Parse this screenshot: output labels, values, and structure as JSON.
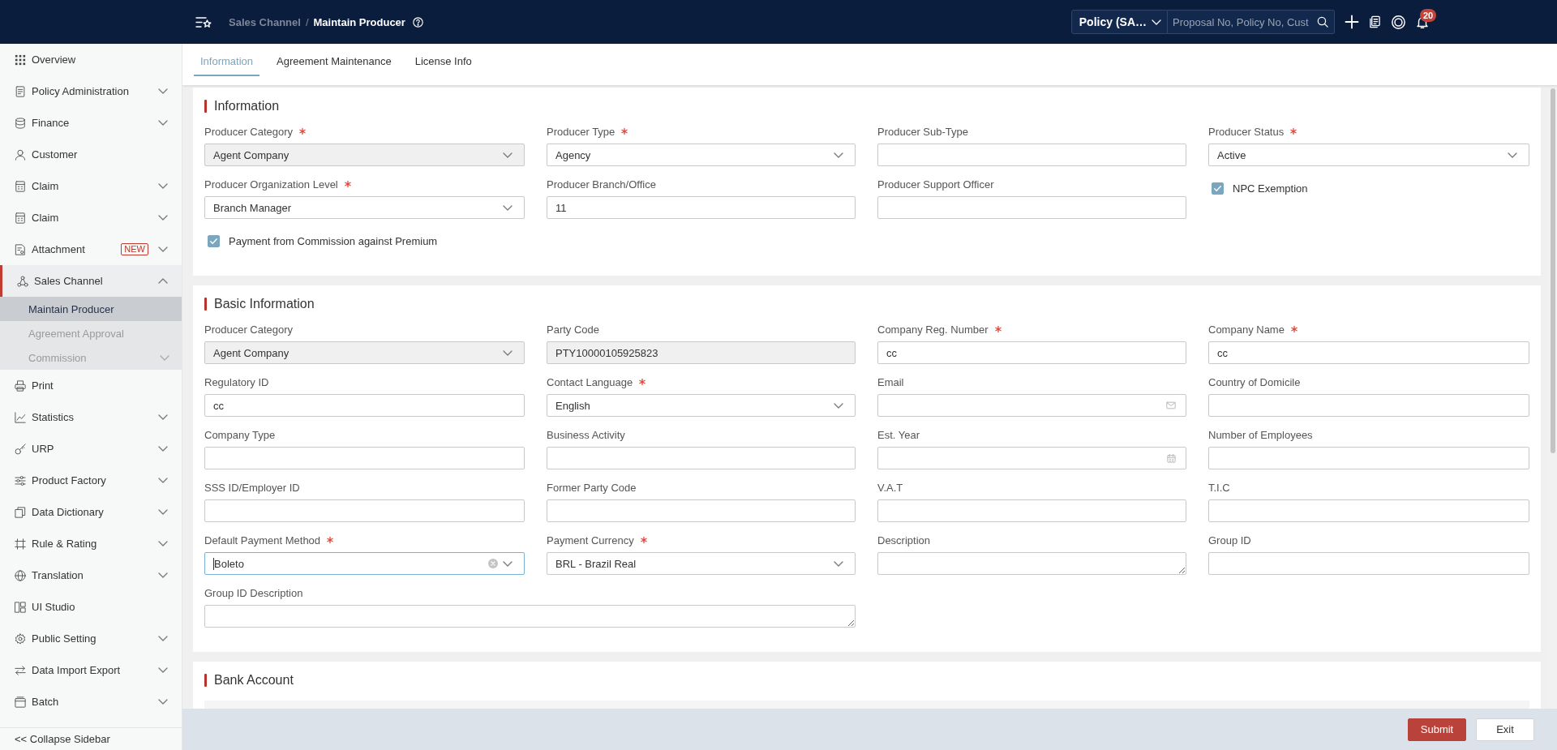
{
  "header": {
    "breadcrumb": [
      {
        "label": "Sales Channel",
        "current": false
      },
      {
        "label": "Maintain Producer",
        "current": true
      }
    ],
    "separator": "/",
    "search": {
      "scope": "Policy (SA…",
      "placeholder": "Proposal No, Policy No, Cust"
    },
    "notification_count": "20"
  },
  "sidebar": {
    "items": [
      {
        "label": "Overview",
        "kind": "link"
      },
      {
        "label": "Policy Administration",
        "kind": "group",
        "expanded": false
      },
      {
        "label": "Finance",
        "kind": "group",
        "expanded": false
      },
      {
        "label": "Customer",
        "kind": "link"
      },
      {
        "label": "Claim",
        "kind": "group",
        "expanded": false
      },
      {
        "label": "Claim",
        "kind": "group",
        "expanded": false
      },
      {
        "label": "Attachment",
        "kind": "group",
        "expanded": false,
        "badge": "NEW"
      },
      {
        "label": "Sales Channel",
        "kind": "group",
        "expanded": true,
        "children": [
          {
            "label": "Maintain Producer",
            "kind": "link",
            "selected": true
          },
          {
            "label": "Agreement Approval",
            "kind": "link",
            "selected": false
          },
          {
            "label": "Commission",
            "kind": "group",
            "selected": false,
            "expanded": false
          }
        ]
      },
      {
        "label": "Print",
        "kind": "link"
      },
      {
        "label": "Statistics",
        "kind": "group",
        "expanded": false
      },
      {
        "label": "URP",
        "kind": "group",
        "expanded": false
      },
      {
        "label": "Product Factory",
        "kind": "group",
        "expanded": false
      },
      {
        "label": "Data Dictionary",
        "kind": "group",
        "expanded": false
      },
      {
        "label": "Rule & Rating",
        "kind": "group",
        "expanded": false
      },
      {
        "label": "Translation",
        "kind": "group",
        "expanded": false
      },
      {
        "label": "UI Studio",
        "kind": "link"
      },
      {
        "label": "Public Setting",
        "kind": "group",
        "expanded": false
      },
      {
        "label": "Data Import Export",
        "kind": "group",
        "expanded": false
      },
      {
        "label": "Batch",
        "kind": "group",
        "expanded": false
      }
    ],
    "collapse_label": "<< Collapse Sidebar"
  },
  "tabs": [
    {
      "label": "Information",
      "selected": true
    },
    {
      "label": "Agreement Maintenance",
      "selected": false
    },
    {
      "label": "License Info",
      "selected": false
    }
  ],
  "sections": [
    {
      "title": "Information",
      "kind": "form",
      "fields": [
        {
          "label": "Producer Category",
          "kind": "select",
          "required": true,
          "disabled": true,
          "focused": false,
          "value": "Agent Company"
        },
        {
          "label": "Producer Type",
          "kind": "select",
          "required": true,
          "disabled": false,
          "focused": false,
          "value": "Agency"
        },
        {
          "label": "Producer Sub-Type",
          "kind": "text",
          "required": false,
          "disabled": false,
          "focused": false
        },
        {
          "label": "Producer Status",
          "kind": "select",
          "required": true,
          "disabled": false,
          "focused": false,
          "value": "Active"
        },
        {
          "label": "Producer Organization Level",
          "kind": "select",
          "required": true,
          "disabled": false,
          "focused": false,
          "value": "Branch Manager"
        },
        {
          "label": "Producer Branch/Office",
          "kind": "text",
          "required": false,
          "disabled": false,
          "focused": false,
          "value": "11"
        },
        {
          "label": "Producer Support Officer",
          "kind": "text",
          "required": false,
          "disabled": false,
          "focused": false
        },
        {
          "label": "NPC Exemption",
          "kind": "checkbox",
          "checked": true
        },
        {
          "label": "Payment from Commission against Premium",
          "kind": "checkbox",
          "checked": true
        }
      ]
    },
    {
      "title": "Basic Information",
      "kind": "form",
      "fields": [
        {
          "label": "Producer Category",
          "kind": "select",
          "required": false,
          "disabled": true,
          "focused": false,
          "value": "Agent Company"
        },
        {
          "label": "Party Code",
          "kind": "text",
          "required": false,
          "disabled": true,
          "focused": false,
          "value": "PTY10000105925823"
        },
        {
          "label": "Company Reg. Number",
          "kind": "text",
          "required": true,
          "disabled": false,
          "focused": false,
          "value": "cc"
        },
        {
          "label": "Company Name",
          "kind": "text",
          "required": true,
          "disabled": false,
          "focused": false,
          "value": "cc"
        },
        {
          "label": "Regulatory ID",
          "kind": "text",
          "required": false,
          "disabled": false,
          "focused": false,
          "value": "cc"
        },
        {
          "label": "Contact Language",
          "kind": "select",
          "required": true,
          "disabled": false,
          "focused": false,
          "value": "English"
        },
        {
          "label": "Email",
          "kind": "email",
          "required": false,
          "disabled": false,
          "focused": false
        },
        {
          "label": "Country of Domicile",
          "kind": "text",
          "required": false,
          "disabled": false,
          "focused": false
        },
        {
          "label": "Company Type",
          "kind": "text",
          "required": false,
          "disabled": false,
          "focused": false
        },
        {
          "label": "Business Activity",
          "kind": "text",
          "required": false,
          "disabled": false,
          "focused": false
        },
        {
          "label": "Est. Year",
          "kind": "date",
          "required": false,
          "disabled": false,
          "focused": false
        },
        {
          "label": "Number of Employees",
          "kind": "text",
          "required": false,
          "disabled": false,
          "focused": false
        },
        {
          "label": "SSS ID/Employer ID",
          "kind": "text",
          "required": false,
          "disabled": false,
          "focused": false
        },
        {
          "label": "Former Party Code",
          "kind": "text",
          "required": false,
          "disabled": false,
          "focused": false
        },
        {
          "label": "V.A.T",
          "kind": "text",
          "required": false,
          "disabled": false,
          "focused": false
        },
        {
          "label": "T.I.C",
          "kind": "text",
          "required": false,
          "disabled": false,
          "focused": false
        },
        {
          "label": "Default Payment Method",
          "kind": "select",
          "required": true,
          "disabled": false,
          "focused": true,
          "value": "Boleto"
        },
        {
          "label": "Payment Currency",
          "kind": "select",
          "required": true,
          "disabled": false,
          "focused": false,
          "value": "BRL - Brazil Real"
        },
        {
          "label": "Description",
          "kind": "textarea",
          "required": false,
          "disabled": false,
          "focused": false
        },
        {
          "label": "Group ID",
          "kind": "text",
          "required": false,
          "disabled": false,
          "focused": false
        },
        {
          "label": "Group ID Description",
          "kind": "wide_textarea",
          "required": false,
          "disabled": false,
          "focused": false
        }
      ]
    },
    {
      "title": "Bank Account",
      "kind": "table"
    }
  ],
  "footer": {
    "buttons": [
      {
        "label": "Submit",
        "kind": "primary"
      },
      {
        "label": "Exit",
        "kind": "default"
      }
    ]
  }
}
